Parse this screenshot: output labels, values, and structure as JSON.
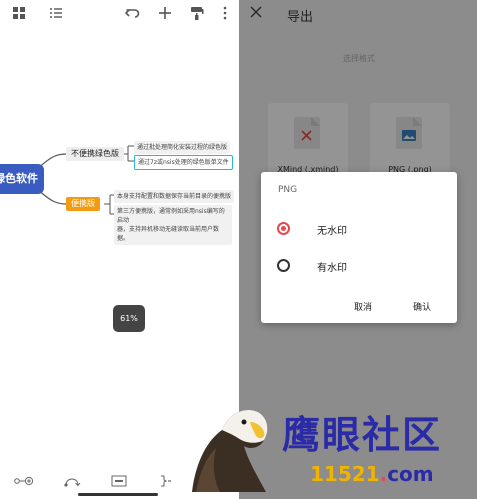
{
  "left": {
    "toolbar": {
      "icons": [
        "grid-icon",
        "list-icon",
        "undo-icon",
        "plus-icon",
        "format-painter-icon",
        "more-vertical-icon"
      ]
    },
    "mindmap": {
      "root": "绿色软件",
      "branch1": "不便携绿色版",
      "branch1_leaf1": "通过批处理简化安装过程的绿色版",
      "branch1_leaf2": "通过7z或nsis处理的绿色版单文件",
      "branch2": "便携版",
      "branch2_leaf1": "本身支持配置和数据保存当前目录的便携版",
      "branch2_leaf2a": "第三方便携版，通常例如采用nsis编写的启动",
      "branch2_leaf2b": "器，支持异机移动无缝读取当前用户数据。"
    },
    "zoom": "61%",
    "bottom_icons": [
      "add-child-icon",
      "connect-icon",
      "summary-icon",
      "bracket-icon"
    ]
  },
  "right": {
    "title": "导出",
    "subtitle": "选择格式",
    "cards": [
      {
        "label": "XMind (.xmind)"
      },
      {
        "label": "PNG (.png)"
      }
    ]
  },
  "dialog": {
    "title": "PNG",
    "options": [
      {
        "label": "无水印",
        "selected": true
      },
      {
        "label": "有水印",
        "selected": false
      }
    ],
    "cancel": "取消",
    "confirm": "确认"
  },
  "watermark": {
    "text": "鹰眼社区",
    "url_num": "11521",
    "url_dot": ".",
    "url_com": "com"
  },
  "colors": {
    "accent": "#e5484d",
    "root_node": "#3a5bbf",
    "portable_node": "#f39c12"
  }
}
